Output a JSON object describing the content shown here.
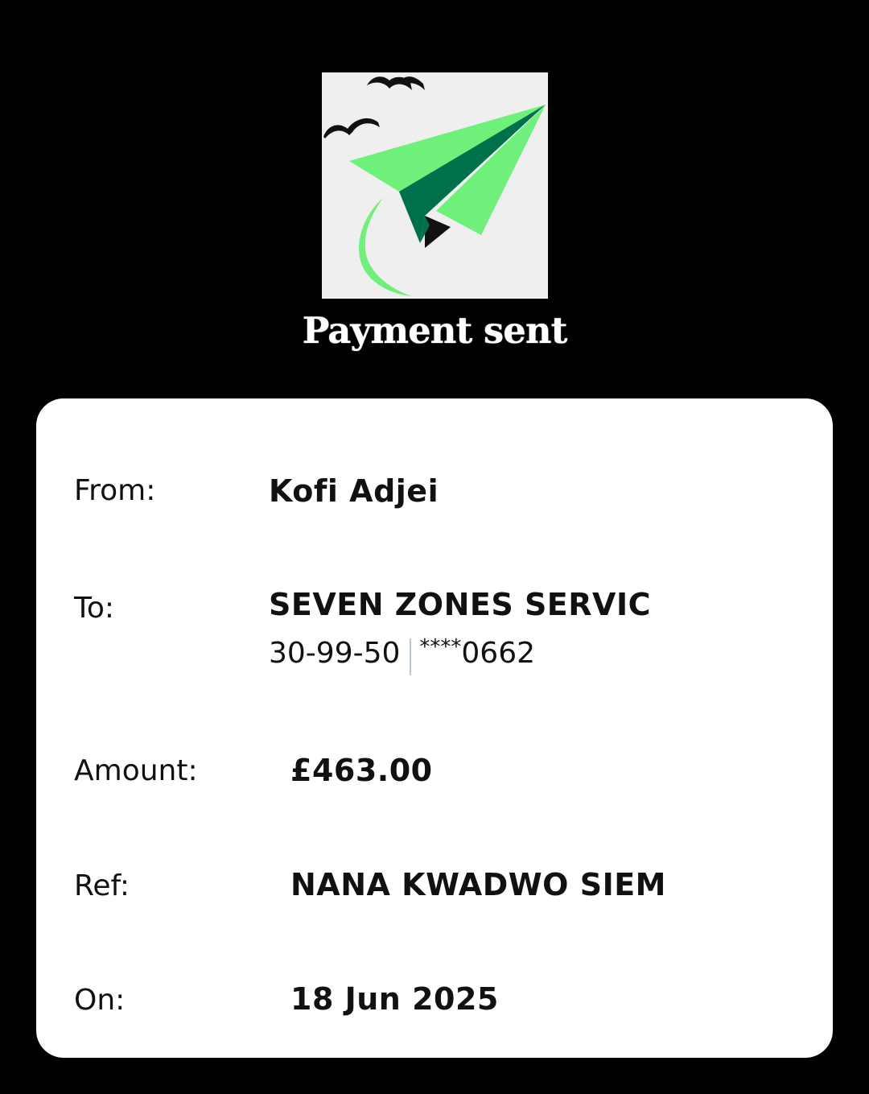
{
  "header": {
    "logo_icon": "paper-plane-with-birds-icon",
    "status_title": "Payment sent"
  },
  "colors": {
    "background": "#000000",
    "card": "#ffffff",
    "plane_light": "#6ef07a",
    "plane_dark": "#00704a",
    "logo_bg": "#efefef"
  },
  "details": {
    "from": {
      "label": "From:",
      "value": "Kofi Adjei"
    },
    "to": {
      "label": "To:",
      "value": "SEVEN ZONES SERVIC",
      "sort_code": "30-99-50",
      "account_mask": "****",
      "account_last": "0662"
    },
    "amount": {
      "label": "Amount:",
      "value": "£463.00"
    },
    "ref": {
      "label": "Ref:",
      "value": "NANA KWADWO SIEM"
    },
    "on": {
      "label": "On:",
      "value": "18 Jun 2025"
    }
  }
}
